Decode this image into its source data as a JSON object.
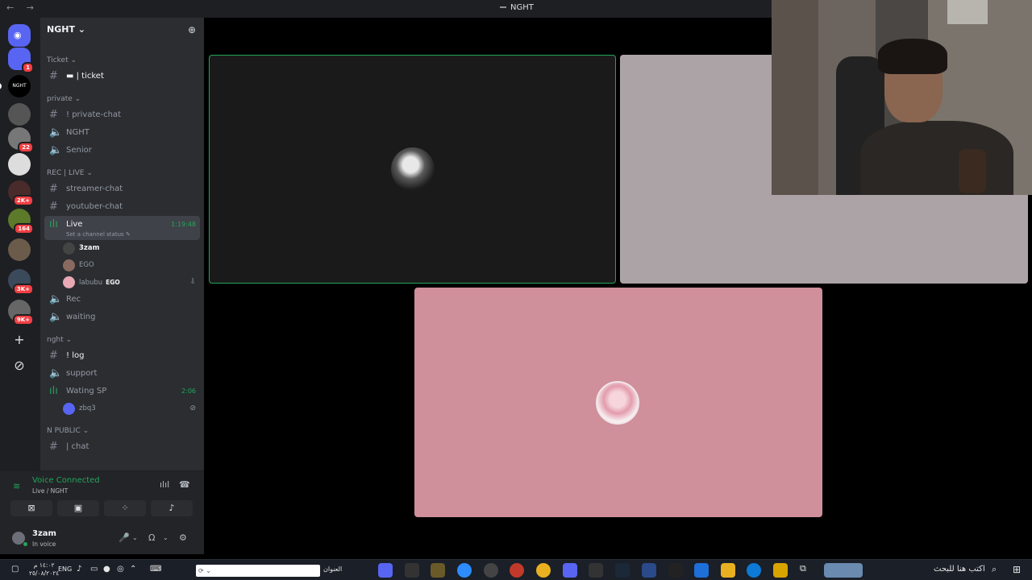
{
  "titlebar": {
    "nav": "← →",
    "title": "NGHT"
  },
  "servers": {
    "items": [
      {
        "name": "direct-messages",
        "badge": "1"
      },
      {
        "name": "NGHT",
        "badge": "",
        "label": "NGHT"
      },
      {
        "name": "server-3",
        "badge": ""
      },
      {
        "name": "server-4",
        "badge": "22"
      },
      {
        "name": "server-5",
        "badge": ""
      },
      {
        "name": "server-6",
        "badge": "2K+"
      },
      {
        "name": "server-7",
        "badge": "164"
      },
      {
        "name": "server-8",
        "badge": ""
      },
      {
        "name": "server-9",
        "badge": "3K+"
      },
      {
        "name": "server-10",
        "badge": "9K+"
      }
    ],
    "add_icon": "+",
    "discover_icon": "⊘"
  },
  "guild": {
    "name": "NGHT ⌄",
    "invite_icon": "person-add-icon"
  },
  "channels": {
    "cat_ticket": "Ticket ⌄",
    "ch_ticket": "▬ | ticket",
    "cat_private": "private ⌄",
    "ch_private_chat": "! private-chat",
    "ch_nght": "NGHT",
    "ch_senior": "Senior",
    "cat_rec_live": "REC | LIVE ⌄",
    "ch_streamer_chat": "streamer-chat",
    "ch_youtuber_chat": "youtuber-chat",
    "ch_live": "Live",
    "ch_live_status": "Set a channel status ✎",
    "ch_live_timer": "1:19:48",
    "member_3zam": "3zam",
    "member_ego": "EGO",
    "member_labubu": "labubu",
    "member_labubu_tag": "EGO",
    "ch_rec": "Rec",
    "ch_waiting": "waiting",
    "cat_nght": "nght ⌄",
    "ch_log": "! log",
    "ch_support": "support",
    "ch_wating_sp": "Wating SP",
    "ch_wating_sp_timer": "2:06",
    "member_zbq3": "zbq3",
    "cat_n_public": "N PUBLIC ⌄",
    "ch_chat": "| chat"
  },
  "voice": {
    "status": "Voice Connected",
    "location": "Live / NGHT"
  },
  "user": {
    "name": "3zam",
    "status": "In voice"
  },
  "taskbar": {
    "clock_time": "١٤:٠٢ م",
    "clock_date": "٢٥/٠٨/٢٠٢٤",
    "lang": "ENG",
    "address_label": "العنوان",
    "search_placeholder": "اكتب هنا للبحث"
  },
  "colors": {
    "accent_green": "#23a55a",
    "blurple": "#5865f2",
    "tile_pink": "#cf8f9b",
    "tile_grey": "#aba3a5"
  }
}
